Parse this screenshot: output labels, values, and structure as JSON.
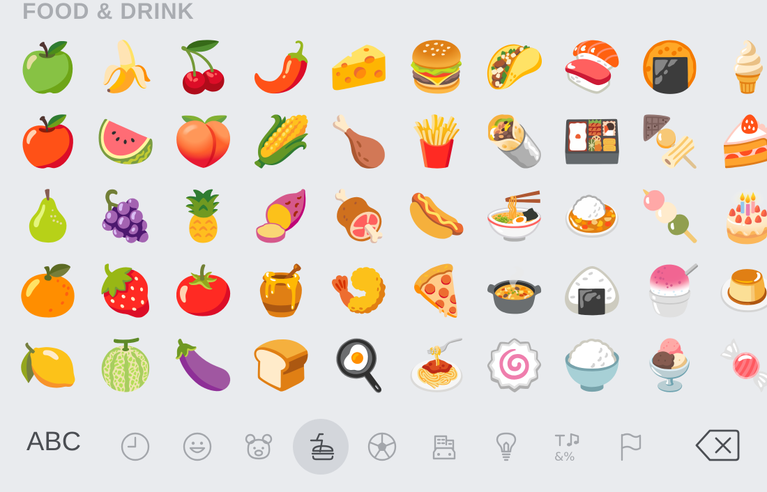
{
  "section": {
    "title": "FOOD & DRINK"
  },
  "emojis": [
    [
      "🍏",
      "🍌",
      "🍒",
      "🌶️",
      "🧀",
      "🍔",
      "🌮",
      "🍣",
      "🍘",
      "🍦"
    ],
    [
      "🍎",
      "🍉",
      "🍑",
      "🌽",
      "🍗",
      "🍟",
      "🌯",
      "🍱",
      "🍢",
      "🍰"
    ],
    [
      "🍐",
      "🍇",
      "🍍",
      "🍠",
      "🍖",
      "🌭",
      "🍜",
      "🍛",
      "🍡",
      "🎂"
    ],
    [
      "🍊",
      "🍓",
      "🍅",
      "🍯",
      "🍤",
      "🍕",
      "🍲",
      "🍙",
      "🍧",
      "🍮"
    ],
    [
      "🍋",
      "🍈",
      "🍆",
      "🍞",
      "🍳",
      "🍝",
      "🍥",
      "🍚",
      "🍨",
      "🍬"
    ]
  ],
  "keyboard": {
    "abc_label": "ABC",
    "categories": [
      {
        "name": "recents-icon"
      },
      {
        "name": "smileys-icon"
      },
      {
        "name": "animals-icon"
      },
      {
        "name": "food-drink-icon",
        "selected": true
      },
      {
        "name": "activity-icon"
      },
      {
        "name": "travel-places-icon"
      },
      {
        "name": "objects-icon"
      },
      {
        "name": "symbols-icon"
      },
      {
        "name": "flags-icon"
      }
    ],
    "backspace": "backspace-icon"
  },
  "colors": {
    "background": "#e9ebee",
    "title": "#a9acb1",
    "icon": "#a3a6ab",
    "selected_bg": "#d3d6db"
  }
}
